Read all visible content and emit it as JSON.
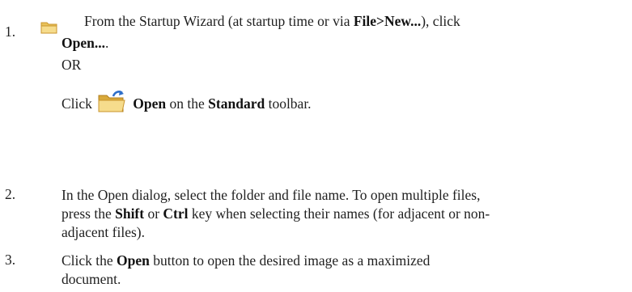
{
  "steps": [
    {
      "number": "1.",
      "text_a": "From the Startup Wizard (at startup time or via ",
      "menu_path": "File>New...",
      "text_b": "), click",
      "open_label": "Open...",
      "open_suffix": ".",
      "or_text": "OR",
      "click_text": "Click",
      "open_toolbar_label": "Open",
      "on_the_text": " on the ",
      "toolbar_name": "Standard",
      "toolbar_suffix": " toolbar."
    },
    {
      "number": "2.",
      "line1": "In the Open dialog, select the folder and file name. To open multiple files,",
      "line2_a": "press the ",
      "shift_key": "Shift",
      "or_word": " or ",
      "ctrl_key": "Ctrl",
      "line2_b": " key when selecting their names (for adjacent or non-",
      "line3": "adjacent files)."
    },
    {
      "number": "3.",
      "click_the": "Click the ",
      "open_button_label": "Open",
      "line1_rest": " button to open the desired image as a maximized",
      "line2": "document."
    }
  ],
  "icons": {
    "step1_small": "folder-icon",
    "step1_toolbar": "open-folder-icon"
  },
  "colors": {
    "text": "#1f1f1f",
    "folder_light": "#f6dc8c",
    "folder_dark": "#d9a93a",
    "arrow_blue": "#2f6fc9"
  }
}
